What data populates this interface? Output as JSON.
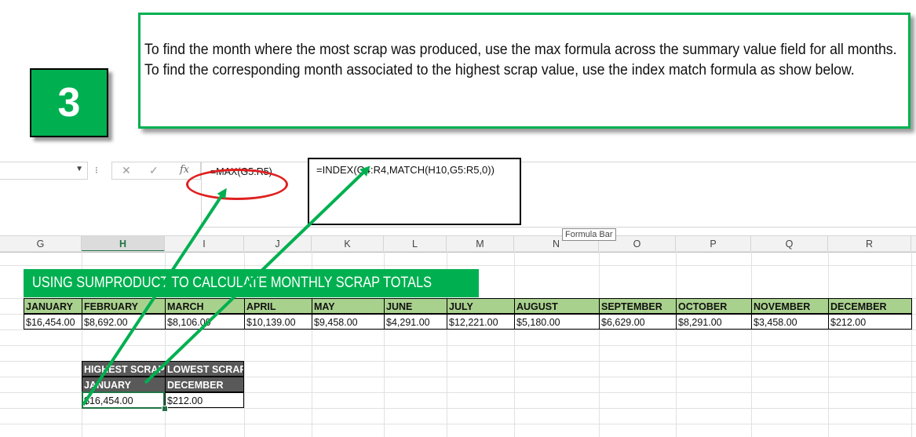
{
  "step": {
    "number": "3",
    "color": "#00b050"
  },
  "instruction": {
    "text": "To find the month where the most scrap was produced, use the max formula across the summary value field for all months. To find the corresponding month associated to the highest scrap value, use the index match formula as show below."
  },
  "formula_bar": {
    "formula": "=MAX(G5:R5)",
    "cancel_icon": "✕",
    "enter_icon": "✓",
    "fx_label": "fx",
    "tooltip": "Formula Bar"
  },
  "callout": {
    "formula": "=INDEX(G4:R4,MATCH(H10,G5:R5,0))"
  },
  "columns": [
    "G",
    "H",
    "I",
    "J",
    "K",
    "L",
    "M",
    "N",
    "O",
    "P",
    "Q",
    "R"
  ],
  "selected_column": "H",
  "banner": {
    "text": "USING SUMPRODUCT TO CALCULATE MONTHLY SCRAP TOTALS"
  },
  "months": [
    {
      "name": "JANUARY",
      "value": "$16,454.00"
    },
    {
      "name": "FEBRUARY",
      "value": "$8,692.00"
    },
    {
      "name": "MARCH",
      "value": "$8,106.00"
    },
    {
      "name": "APRIL",
      "value": "$10,139.00"
    },
    {
      "name": "MAY",
      "value": "$9,458.00"
    },
    {
      "name": "JUNE",
      "value": "$4,291.00"
    },
    {
      "name": "JULY",
      "value": "$12,221.00"
    },
    {
      "name": "AUGUST",
      "value": "$5,180.00"
    },
    {
      "name": "SEPTEMBER",
      "value": "$6,629.00"
    },
    {
      "name": "OCTOBER",
      "value": "$8,291.00"
    },
    {
      "name": "NOVEMBER",
      "value": "$3,458.00"
    },
    {
      "name": "DECEMBER",
      "value": "$212.00"
    }
  ],
  "summary": {
    "headers": [
      "HIGHEST SCRAP",
      "LOWEST SCRAP"
    ],
    "months": [
      "JANUARY",
      "DECEMBER"
    ],
    "values": [
      "$16,454.00",
      "$212.00"
    ]
  },
  "colors": {
    "accent_green": "#00b050",
    "month_header": "#a9d18e",
    "dark_header": "#595959",
    "circle": "#e02020",
    "selection": "#217346"
  }
}
